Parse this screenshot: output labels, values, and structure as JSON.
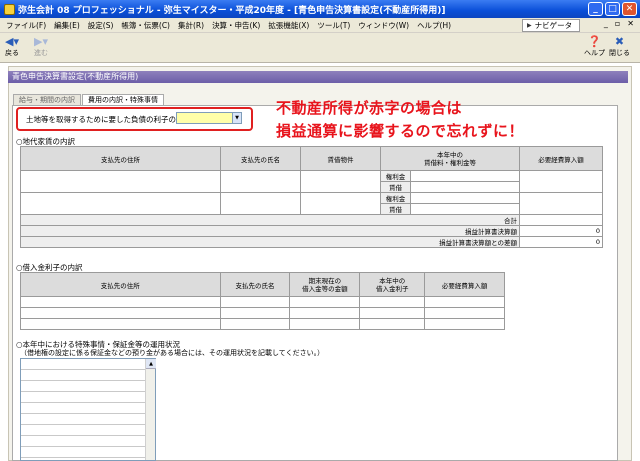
{
  "window": {
    "title": "弥生会計 08 プロフェッショナル - 弥生マイスター・平成20年度 - [青色申告決算書設定(不動産所得用)]"
  },
  "menu": {
    "items": [
      "ファイル(F)",
      "編集(E)",
      "設定(S)",
      "帳簿・伝票(C)",
      "集計(R)",
      "決算・申告(K)",
      "拡張機能(X)",
      "ツール(T)",
      "ウィンドウ(W)",
      "ヘルプ(H)"
    ],
    "navi_label": "ナビゲータ"
  },
  "toolbar": {
    "back_label": "戻る",
    "forward_label": "進む",
    "help_label": "ヘルプ",
    "close_label": "閉じる"
  },
  "page": {
    "section_title": "青色申告決算書設定(不動産所得用)",
    "tabs": [
      {
        "label": "給与・期間の内訳"
      },
      {
        "label": "費用の内訳・特殊事情"
      }
    ],
    "land_interest_label": "土地等を取得するために要した負債の利子の額",
    "land_interest_value": ""
  },
  "callout": {
    "line1": "不動産所得が赤字の場合は",
    "line2": "損益通算に影響するので忘れずに！"
  },
  "rent": {
    "title": "○地代家賃の内訳",
    "headers": [
      "支払先の住所",
      "支払先の氏名",
      "賃借物件",
      "本年中の\n賃借料・権利金等",
      "必要経費算入額"
    ],
    "sub_labels": [
      "権利金",
      "賃借",
      "権利金",
      "賃借"
    ],
    "total_label": "合計",
    "pl_label": "損益計算書決算額",
    "pl_value": "0",
    "diff_label": "損益計算書決算額との差額",
    "diff_value": "0"
  },
  "loan": {
    "title": "○借入金利子の内訳",
    "headers": [
      "支払先の住所",
      "支払先の氏名",
      "期末現在の\n借入金等の金額",
      "本年中の\n借入金利子",
      "必要経費算入額"
    ]
  },
  "special": {
    "title": "○本年中における特殊事情・保証金等の運用状況",
    "note": "（借地権の設定に係る保証金などの預り金がある場合には、その運用状況を記載してください。）"
  }
}
